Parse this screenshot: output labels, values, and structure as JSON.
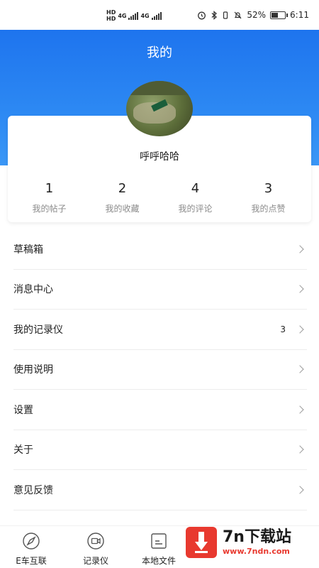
{
  "status_bar": {
    "left_label_1": "HD",
    "left_label_2": "HD",
    "net_1": "4G",
    "net_2": "4G",
    "battery_percent": "52%",
    "battery_level": 0.52,
    "time": "6:11"
  },
  "header": {
    "title": "我的"
  },
  "profile": {
    "username": "呼呼哈哈",
    "stats": [
      {
        "value": "1",
        "label": "我的帖子"
      },
      {
        "value": "2",
        "label": "我的收藏"
      },
      {
        "value": "4",
        "label": "我的评论"
      },
      {
        "value": "3",
        "label": "我的点赞"
      }
    ]
  },
  "menu": [
    {
      "label": "草稿箱",
      "badge": ""
    },
    {
      "label": "消息中心",
      "badge": ""
    },
    {
      "label": "我的记录仪",
      "badge": "3"
    },
    {
      "label": "使用说明",
      "badge": ""
    },
    {
      "label": "设置",
      "badge": ""
    },
    {
      "label": "关于",
      "badge": ""
    },
    {
      "label": "意见反馈",
      "badge": ""
    }
  ],
  "tabbar": {
    "tabs": [
      {
        "label": "E车互联",
        "icon": "compass-icon"
      },
      {
        "label": "记录仪",
        "icon": "camera-icon"
      },
      {
        "label": "本地文件",
        "icon": "file-icon"
      }
    ]
  },
  "watermark": {
    "brand": "7n下载站",
    "url": "www.7ndn.com"
  },
  "colors": {
    "header_blue": "#1e74ee",
    "watermark_red": "#e8392f"
  }
}
